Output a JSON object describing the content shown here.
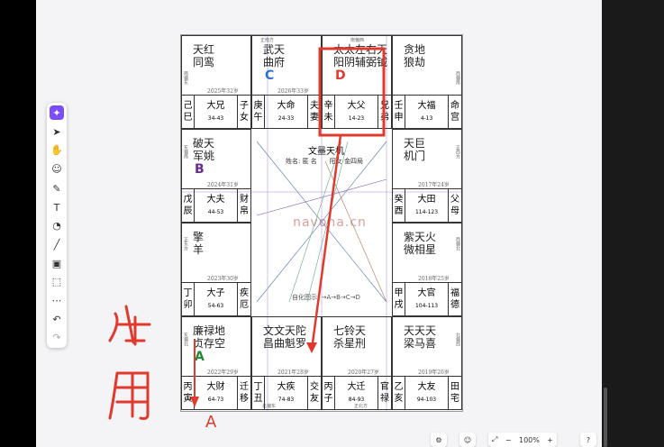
{
  "toolbar": {
    "icons": [
      "magic-wand-icon",
      "pointer-icon",
      "hand-icon",
      "sticker-icon",
      "pen-icon",
      "text-icon",
      "shapes-icon",
      "line-icon",
      "image-icon",
      "frame-icon",
      "more-icon",
      "undo-icon",
      "redo-icon"
    ]
  },
  "chart": {
    "dir_top_left": "正南方",
    "dir_top_right": "南偏西",
    "dir_bottom_left": "北偏东",
    "dir_bottom_right": "正北方",
    "dir_left_1": "南偏东",
    "dir_left_2": "东偏南",
    "dir_left_3": "正东方",
    "dir_left_4": "东偏北",
    "dir_right_1": "西偏南",
    "dir_right_2": "正西方",
    "dir_right_3": "西偏北",
    "dir_right_4": "北偏西",
    "center_title": "文墨天机",
    "center_info": "姓名: 匿 名　　阳女 金四局",
    "center_legend": "自化图示: →A→B→C→D",
    "watermark": "navona.cn",
    "cells": [
      {
        "s1": "天红",
        "s2": "同鸾",
        "year": "2025年32岁",
        "trans": "",
        "stem": "己",
        "branch": "巳",
        "dx": "大兄",
        "rng": "34-43",
        "p1": "子",
        "p2": "女"
      },
      {
        "s1": "武天",
        "s2": "曲府",
        "year": "2026年33岁",
        "trans": "C",
        "stem": "庚",
        "branch": "午",
        "dx": "大命",
        "rng": "24-33",
        "p1": "夫",
        "p2": "妻"
      },
      {
        "s1": "太太左右天",
        "s2": "阳阴辅弼钺",
        "year": "",
        "trans": "D",
        "stem": "辛",
        "branch": "未",
        "dx": "大父",
        "rng": "14-23",
        "p1": "兄",
        "p2": "弟"
      },
      {
        "s1": "贪地",
        "s2": "狼劫",
        "year": "",
        "trans": "",
        "stem": "壬",
        "branch": "申",
        "dx": "大福",
        "rng": "4-13",
        "p1": "命",
        "p2": "宫"
      },
      {
        "s1": "破天",
        "s2": "军姚",
        "year": "2024年31岁",
        "trans": "B",
        "stem": "戊",
        "branch": "辰",
        "dx": "大夫",
        "rng": "44-53",
        "p1": "财",
        "p2": "帛"
      },
      {
        "s1": "天巨",
        "s2": "机门",
        "year": "2017年24岁",
        "trans": "",
        "stem": "癸",
        "branch": "酉",
        "dx": "大田",
        "rng": "114-123",
        "p1": "父",
        "p2": "母"
      },
      {
        "s1": "擎",
        "s2": "羊",
        "year": "2023年30岁",
        "trans": "",
        "stem": "丁",
        "branch": "卯",
        "dx": "大子",
        "rng": "54-63",
        "p1": "疾",
        "p2": "厄"
      },
      {
        "s1": "紫天火",
        "s2": "微相星",
        "year": "2018年25岁",
        "trans": "",
        "stem": "甲",
        "branch": "戌",
        "dx": "大官",
        "rng": "104-113",
        "p1": "福",
        "p2": "德"
      },
      {
        "s1": "廉禄地",
        "s2": "贞存空",
        "year": "2022年29岁",
        "trans": "A",
        "stem": "丙",
        "branch": "寅",
        "dx": "大财",
        "rng": "64-73",
        "p1": "迁",
        "p2": "移"
      },
      {
        "s1": "文文天陀",
        "s2": "昌曲魁罗",
        "year": "2021年28岁",
        "trans": "",
        "stem": "丁",
        "branch": "丑",
        "dx": "大疾",
        "rng": "74-83",
        "p1": "交",
        "p2": "友"
      },
      {
        "s1": "七铃天",
        "s2": "杀星刑",
        "year": "2020年27岁",
        "trans": "",
        "stem": "丙",
        "branch": "子",
        "dx": "大迁",
        "rng": "84-93",
        "p1": "官",
        "p2": "禄"
      },
      {
        "s1": "天天天",
        "s2": "梁马喜",
        "year": "2019年26岁",
        "trans": "",
        "stem": "乙",
        "branch": "亥",
        "dx": "大友",
        "rng": "94-103",
        "p1": "田",
        "p2": "宅"
      }
    ]
  },
  "annotation": {
    "handwriting": "体用",
    "label_a": "A"
  },
  "bottombar": {
    "zoom": "100%",
    "minus": "−",
    "plus": "+"
  },
  "colors": {
    "accent": "#7c4dff",
    "red": "#e03a2f",
    "blue_c": "#2a6fd6",
    "purple_b": "#6a2c8c",
    "green_a": "#1f8a3c"
  }
}
